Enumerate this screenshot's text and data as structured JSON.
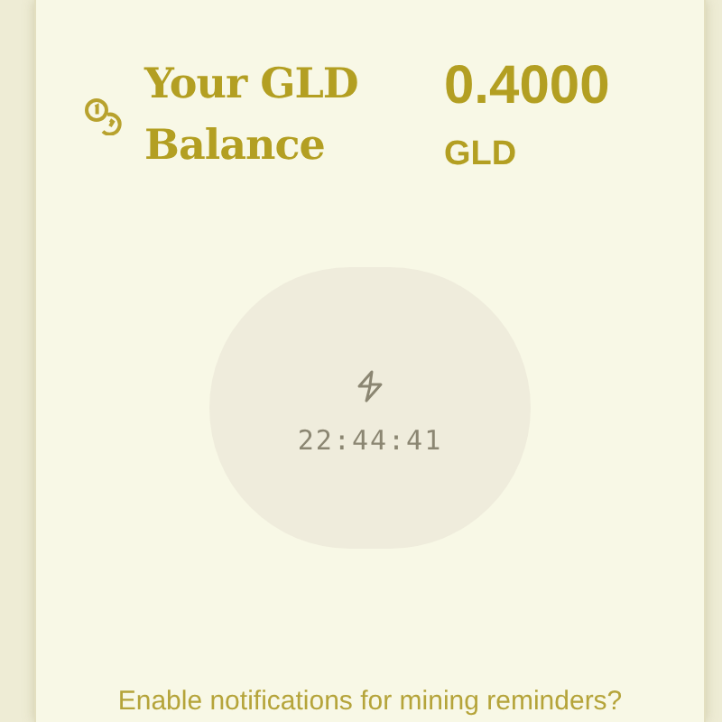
{
  "balance": {
    "title": "Your GLD Balance",
    "amount": "0.4000",
    "unit": "GLD"
  },
  "mining": {
    "timer": "22:44:41"
  },
  "notification_prompt": "Enable notifications for mining reminders?"
}
